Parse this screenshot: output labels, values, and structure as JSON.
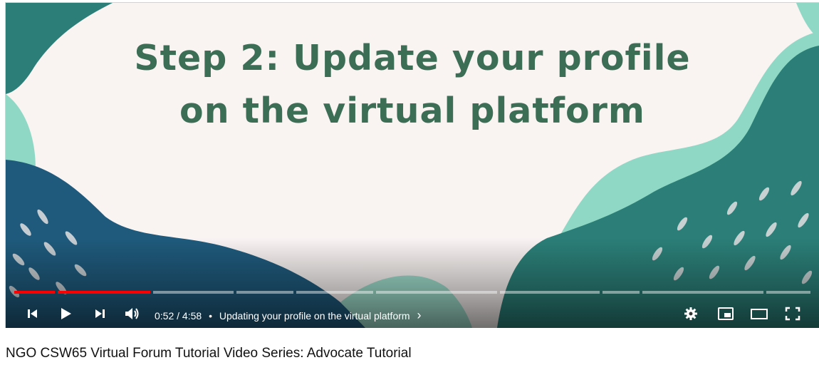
{
  "slide": {
    "title_line1": "Step 2: Update your profile",
    "title_line2": "on the virtual platform"
  },
  "player": {
    "current_time": "0:52",
    "duration": "4:58",
    "separator": "/",
    "chapter_bullet": "•",
    "chapter_title": "Updating your profile on the virtual platform",
    "chapter_chevron": "›",
    "progress_fraction": 0.175,
    "buttons": {
      "previous": "skip-previous-icon",
      "play": "play-icon",
      "next": "skip-next-icon",
      "volume": "volume-icon",
      "settings": "settings-gear-icon",
      "miniplayer": "miniplayer-icon",
      "theater": "theater-mode-icon",
      "fullscreen": "fullscreen-icon"
    },
    "colors": {
      "played": "#ff0000",
      "title_text": "#3c6e56",
      "teal_dark": "#2b7f78",
      "teal_light": "#8fd8c5",
      "navy": "#1f5a7c"
    }
  },
  "video_title": "NGO CSW65 Virtual Forum Tutorial Video Series: Advocate Tutorial"
}
